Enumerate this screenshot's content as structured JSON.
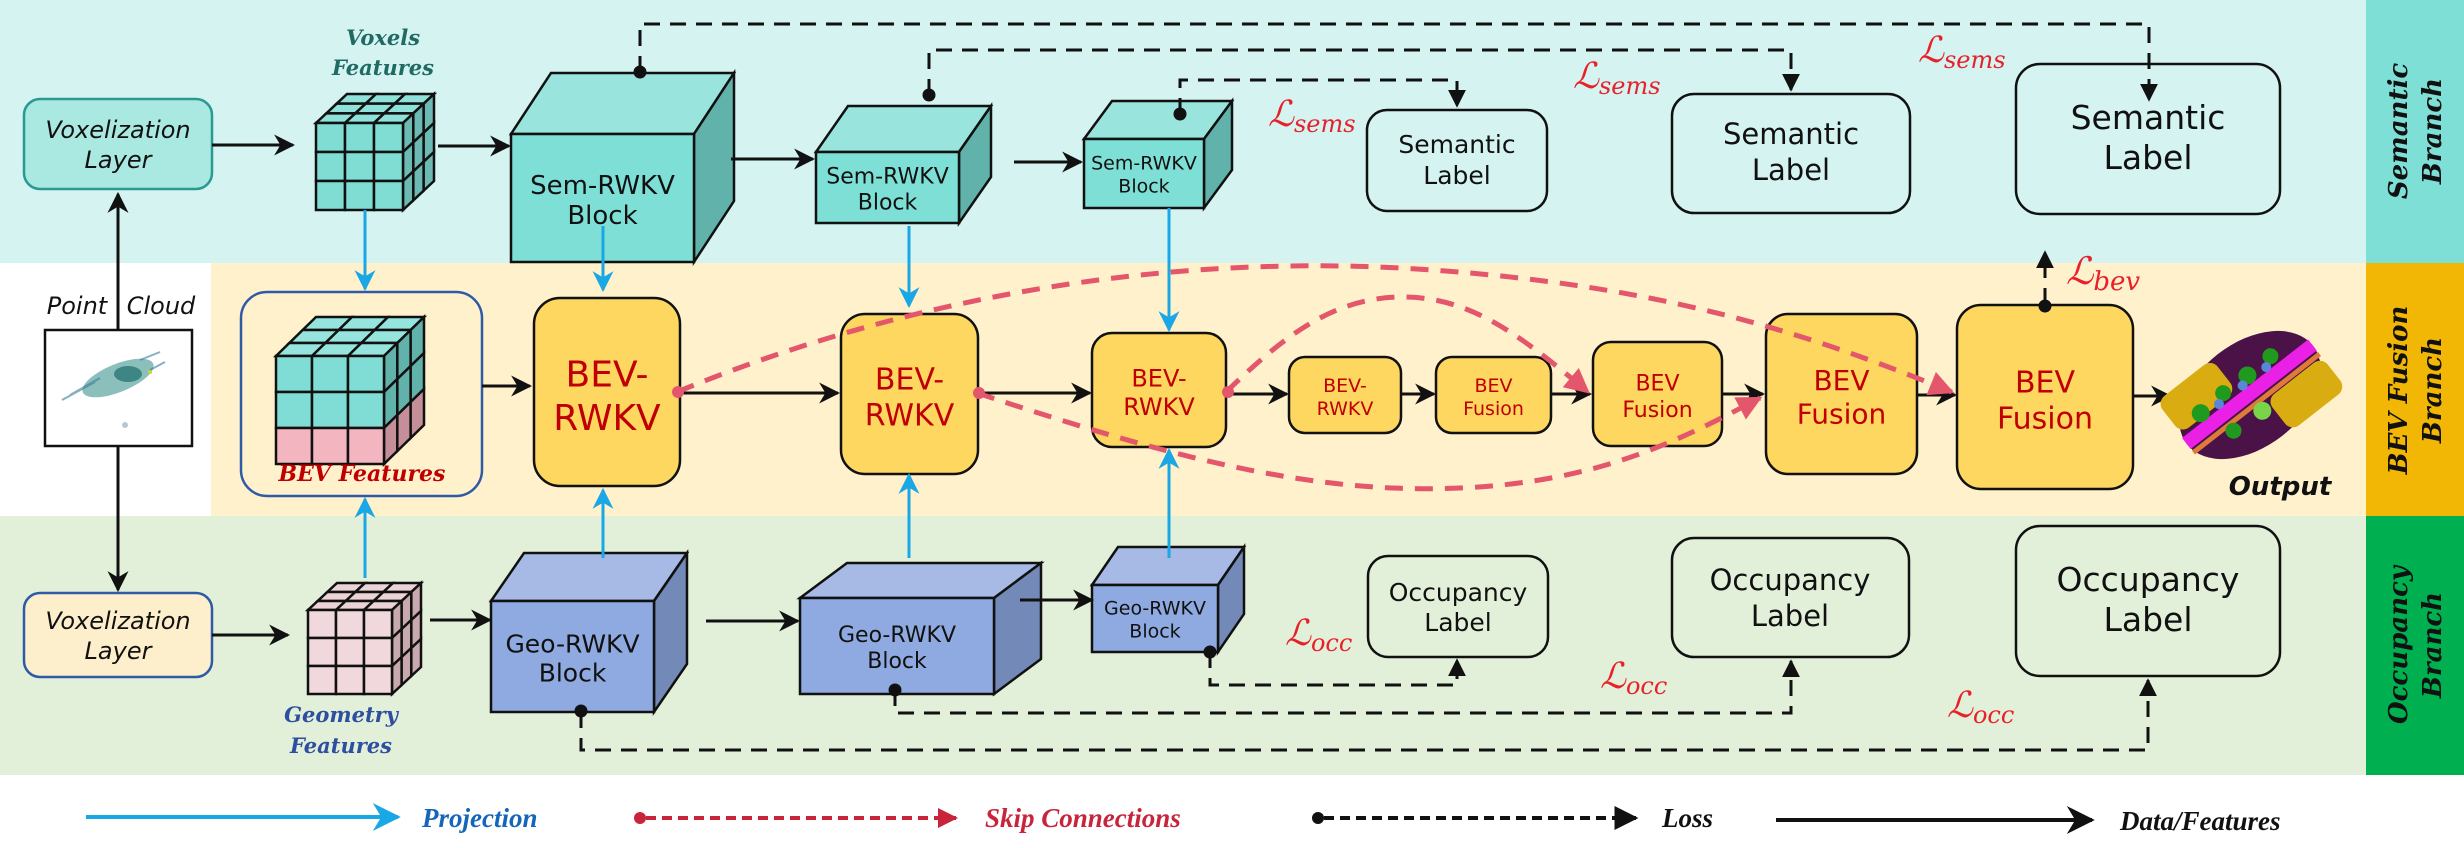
{
  "branches": {
    "semantic": {
      "label_line1": "Semantic",
      "label_line2": "Branch",
      "band_color": "#d4f3f1",
      "tab_color": "#7ddfd6"
    },
    "bev": {
      "label_line1": "BEV Fusion",
      "label_line2": "Branch",
      "band_color": "#fff1cc",
      "tab_color": "#f2b705"
    },
    "occupancy": {
      "label_line1": "Occupancy",
      "label_line2": "Branch",
      "band_color": "#e3f0d9",
      "tab_color": "#00b050"
    }
  },
  "input": {
    "point_cloud_word1": "Point",
    "point_cloud_word2": "Cloud",
    "vox_top_line1": "Voxelization",
    "vox_top_line2": "Layer",
    "vox_bottom_line1": "Voxelization",
    "vox_bottom_line2": "Layer"
  },
  "features": {
    "voxels_line1": "Voxels",
    "voxels_line2": "Features",
    "bev": "BEV  Features",
    "geometry_line1": "Geometry",
    "geometry_line2": "Features"
  },
  "sem_blocks": [
    {
      "line1": "Sem-RWKV",
      "line2": "Block"
    },
    {
      "line1": "Sem-RWKV",
      "line2": "Block"
    },
    {
      "line1": "Sem-RWKV",
      "line2": "Block"
    }
  ],
  "geo_blocks": [
    {
      "line1": "Geo-RWKV",
      "line2": "Block"
    },
    {
      "line1": "Geo-RWKV",
      "line2": "Block"
    },
    {
      "line1": "Geo-RWKV",
      "line2": "Block"
    }
  ],
  "bev_blocks": [
    {
      "line1": "BEV-",
      "line2": "RWKV"
    },
    {
      "line1": "BEV-",
      "line2": "RWKV"
    },
    {
      "line1": "BEV-",
      "line2": "RWKV"
    },
    {
      "line1": "BEV-",
      "line2": "RWKV"
    },
    {
      "line1": "BEV",
      "line2": "Fusion"
    },
    {
      "line1": "BEV",
      "line2": "Fusion"
    },
    {
      "line1": "BEV",
      "line2": "Fusion"
    },
    {
      "line1": "BEV",
      "line2": "Fusion"
    }
  ],
  "semantic_labels": [
    {
      "line1": "Semantic",
      "line2": "Label"
    },
    {
      "line1": "Semantic",
      "line2": "Label"
    },
    {
      "line1": "Semantic",
      "line2": "Label"
    }
  ],
  "occupancy_labels": [
    {
      "line1": "Occupancy",
      "line2": "Label"
    },
    {
      "line1": "Occupancy",
      "line2": "Label"
    },
    {
      "line1": "Occupancy",
      "line2": "Label"
    }
  ],
  "losses": {
    "sems_symbol": "ℒ",
    "sems_sub": "sems",
    "occ_symbol": "ℒ",
    "occ_sub": "occ",
    "bev_symbol": "ℒ",
    "bev_sub": "bev"
  },
  "output_label": "Output",
  "legend": [
    {
      "label": "Projection",
      "color": "#1aa7e6",
      "style": "solid"
    },
    {
      "label": "Skip Connections",
      "color": "#c8243c",
      "style": "dashed-dot"
    },
    {
      "label": "Loss",
      "color": "#111111",
      "style": "dashed-dot"
    },
    {
      "label": "Data/Features",
      "color": "#111111",
      "style": "solid"
    }
  ],
  "colors": {
    "projection": "#1aa7e6",
    "skip": "#e4566c",
    "loss_text": "#e8202a",
    "bev_block_fill": "#fdd75f",
    "bev_text": "#c00000",
    "sem_block_front": "#7ddfd6",
    "sem_block_top": "#99e4dd",
    "sem_block_side": "#60b2aa",
    "geo_block_front": "#8eaae0",
    "geo_block_top": "#a6bae5",
    "geo_block_side": "#7389b7"
  }
}
